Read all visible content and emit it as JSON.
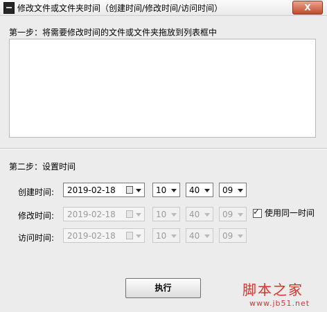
{
  "window": {
    "title": "修改文件或文件夹时间（创建时间/修改时间/访问时间）",
    "close_label": "X"
  },
  "step1": {
    "label": "第一步：将需要修改时间的文件或文件夹拖放到列表框中"
  },
  "step2": {
    "label": "第二步：设置时间"
  },
  "rows": [
    {
      "label": "创建时间:",
      "date": "2019-02-18",
      "hour": "10",
      "minute": "40",
      "second": "09",
      "enabled": true
    },
    {
      "label": "修改时间:",
      "date": "2019-02-18",
      "hour": "10",
      "minute": "40",
      "second": "09",
      "enabled": false
    },
    {
      "label": "访问时间:",
      "date": "2019-02-18",
      "hour": "10",
      "minute": "40",
      "second": "09",
      "enabled": false
    }
  ],
  "same_time": {
    "label": "使用同一时间",
    "checked": true
  },
  "run_button": {
    "label": "执行"
  },
  "watermark": {
    "logo": "脚本之家",
    "url": "www.jb51.net"
  }
}
